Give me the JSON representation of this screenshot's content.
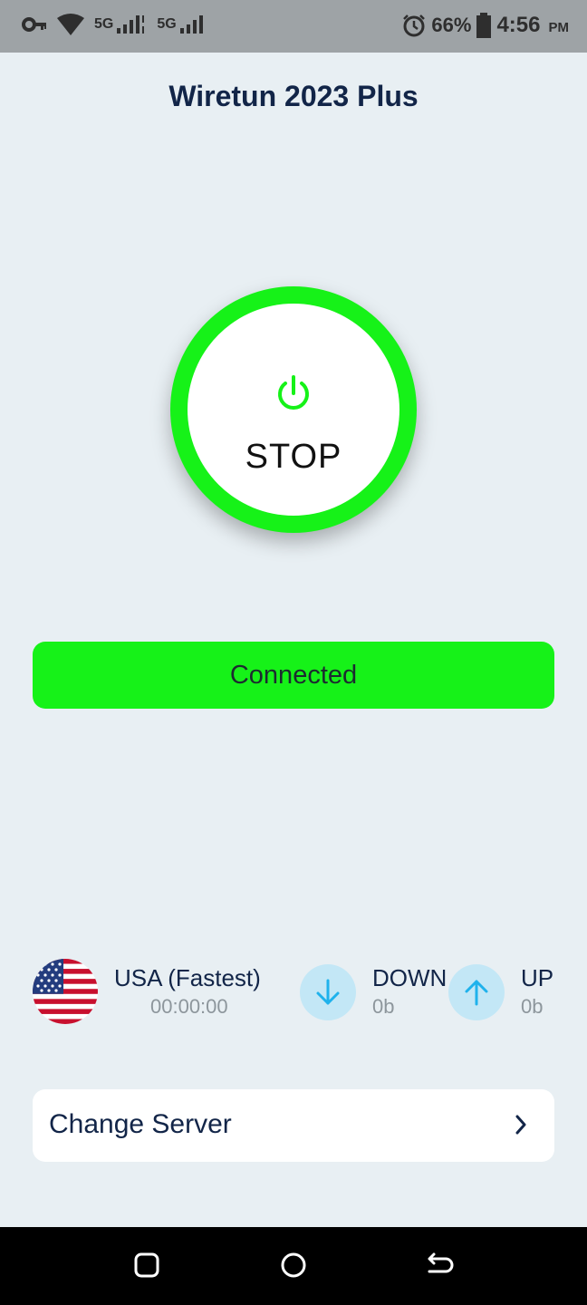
{
  "status_bar": {
    "network_1": "5G",
    "network_2": "5G",
    "battery": "66%",
    "time": "4:56",
    "ampm": "PM",
    "icons": [
      "vpn-key-icon",
      "wifi-icon",
      "signal-icon",
      "alarm-icon",
      "battery-icon"
    ]
  },
  "app": {
    "title": "Wiretun 2023 Plus"
  },
  "power_button": {
    "label": "STOP",
    "icon": "power-icon",
    "ring_color": "#16f218"
  },
  "status": {
    "label": "Connected",
    "color": "#16f218"
  },
  "server": {
    "name": "USA (Fastest)",
    "duration": "00:00:00",
    "flag_icon": "usa-flag-icon"
  },
  "traffic": {
    "down_label": "DOWN",
    "down_value": "0b",
    "up_label": "UP",
    "up_value": "0b",
    "icon_color": "#1fb2ec"
  },
  "change_server": {
    "label": "Change Server",
    "icon": "chevron-right-icon"
  },
  "nav_bar": {
    "icons": [
      "recents-icon",
      "home-icon",
      "back-icon"
    ]
  }
}
